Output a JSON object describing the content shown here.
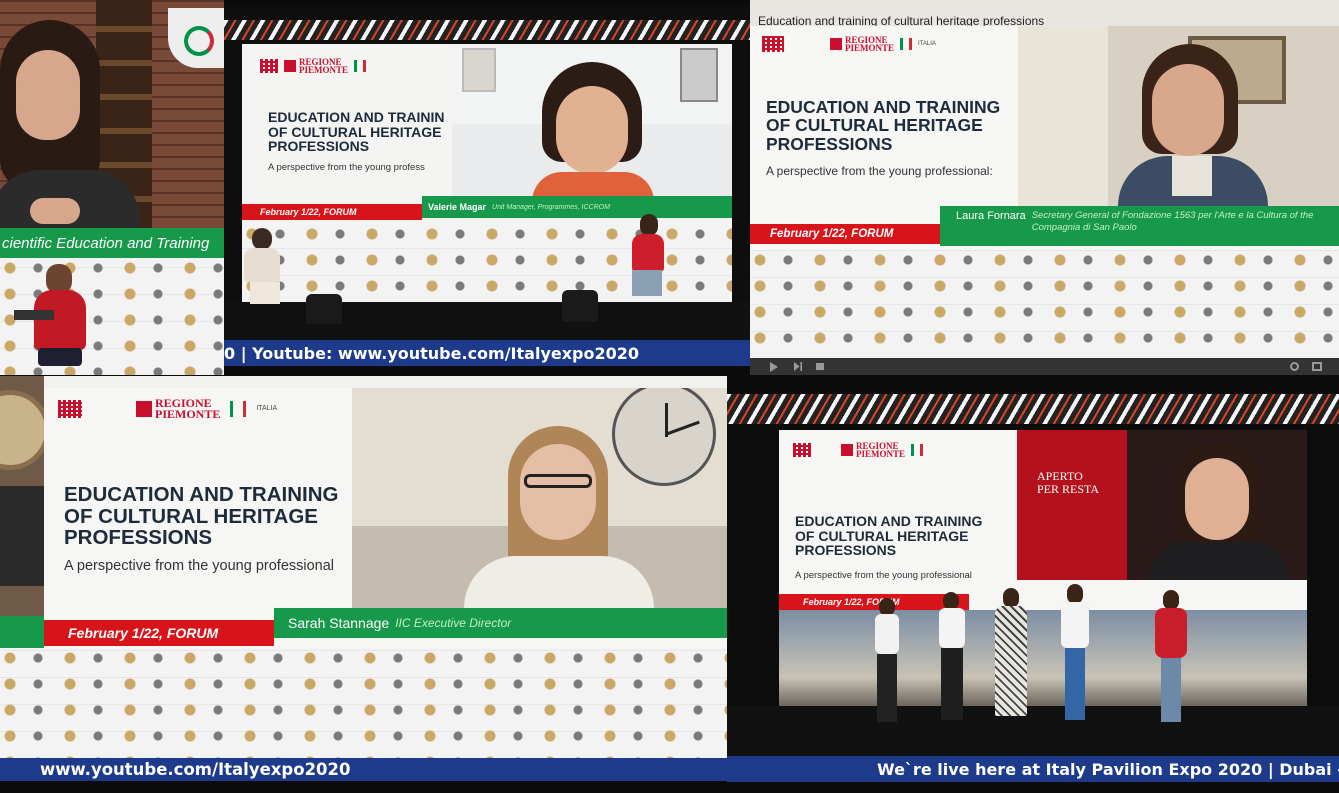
{
  "colors": {
    "green": "#16994a",
    "red": "#d7141a",
    "navy": "#1e3a8a",
    "title": "#1e2b3a"
  },
  "logos": {
    "regione": "REGIONE\nPIEMONTE",
    "italia": "ITALIA"
  },
  "panel1": {
    "caption": "cientific Education and Training"
  },
  "panel2": {
    "title": "EDUCATION AND TRAININ\nOF CULTURAL HERITAGE\nPROFESSIONS",
    "subtitle": "A perspective from the young profess",
    "date": "February 1/22, FORUM",
    "speaker_name": "Valerie Magar",
    "speaker_role": "Unit Manager, Programmes, ICCROM",
    "ticker": "0 | Youtube: www.youtube.com/Italyexpo2020"
  },
  "panel3": {
    "window_title": "Education and training of cultural heritage professions",
    "title": "EDUCATION AND TRAINING\nOF CULTURAL HERITAGE\nPROFESSIONS",
    "subtitle": "A perspective from the young professional:",
    "date": "February 1/22, FORUM",
    "speaker_name": "Laura Fornara",
    "speaker_role": "Secretary General of Fondazione 1563 per l'Arte e la Cultura of the Compagnia di San Paolo"
  },
  "panel4": {
    "title": "EDUCATION AND TRAINING\nOF CULTURAL HERITAGE\nPROFESSIONS",
    "subtitle": "A perspective from the young professional",
    "date": "February 1/22, FORUM",
    "speaker_name": "Sarah Stannage",
    "speaker_role": "IIC Executive Director",
    "ticker": "www.youtube.com/Italyexpo2020"
  },
  "panel5": {
    "title": "EDUCATION AND TRAINING\nOF CULTURAL HERITAGE\nPROFESSIONS",
    "subtitle": "A perspective from the young professional",
    "date": "February 1/22, FORUM",
    "sign": "APERTO\nPER RESTA",
    "ticker": "We`re live here at Italy Pavilion Expo 2020 | Dubai -"
  }
}
